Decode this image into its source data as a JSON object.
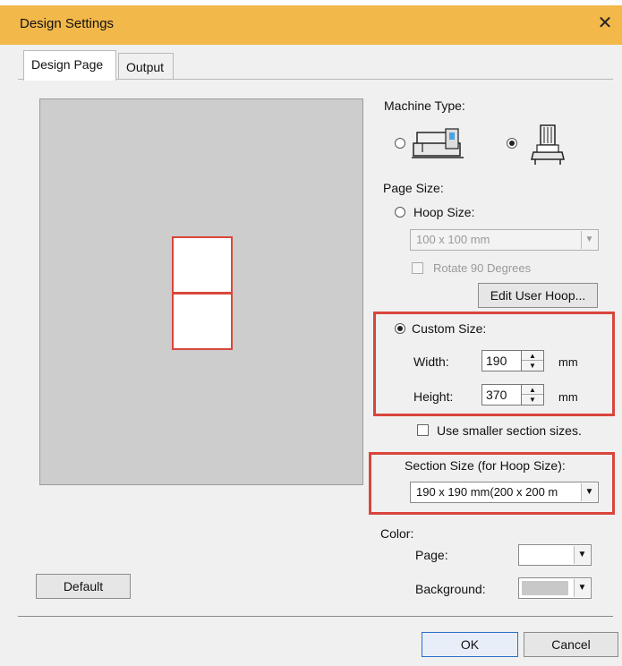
{
  "window": {
    "title": "Design Settings",
    "close_glyph": "✕"
  },
  "tabs": [
    {
      "label": "Design Page",
      "active": true
    },
    {
      "label": "Output",
      "active": false
    }
  ],
  "machine_type": {
    "label": "Machine Type:",
    "options": [
      {
        "icon": "single-needle-machine-icon",
        "selected": false
      },
      {
        "icon": "multi-needle-machine-icon",
        "selected": true
      }
    ]
  },
  "page_size": {
    "label": "Page Size:",
    "hoop_size": {
      "label": "Hoop Size:",
      "selected": false,
      "value": "100 x 100 mm",
      "enabled": false
    },
    "rotate_90": {
      "label": "Rotate 90 Degrees",
      "checked": false,
      "enabled": false
    },
    "edit_user_hoop_label": "Edit User Hoop...",
    "custom_size": {
      "label": "Custom Size:",
      "selected": true,
      "width_label": "Width:",
      "width_value": "190",
      "height_label": "Height:",
      "height_value": "370",
      "unit": "mm"
    },
    "use_smaller_sections": {
      "label": "Use smaller section sizes.",
      "checked": false
    }
  },
  "section_size": {
    "label": "Section Size (for Hoop Size):",
    "value": "190 x 190 mm(200 x 200 m"
  },
  "color": {
    "label": "Color:",
    "page_label": "Page:",
    "page_color": "#ffffff",
    "background_label": "Background:",
    "background_color": "#c8c8c8"
  },
  "buttons": {
    "default_label": "Default",
    "ok_label": "OK",
    "cancel_label": "Cancel"
  },
  "colors": {
    "titlebar": "#f2b84a",
    "highlight": "#d9453c",
    "preview_bg": "#cdcdcd"
  }
}
